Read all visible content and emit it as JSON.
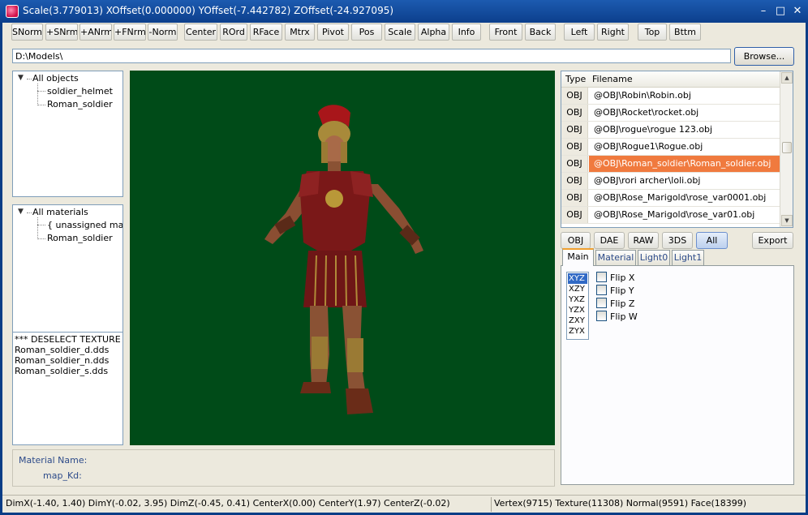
{
  "window": {
    "title": "Scale(3.779013) XOffset(0.000000) YOffset(-7.442782) ZOffset(-24.927095)",
    "controls": {
      "minimize": "–",
      "maximize": "□",
      "close": "✕"
    },
    "icon": "app-cube-icon"
  },
  "toolbar": {
    "buttons": [
      "SNorm",
      "+SNrm",
      "+ANrm",
      "+FNrm",
      "-Norm",
      "Center",
      "ROrd",
      "RFace",
      "Mtrx",
      "Pivot",
      "Pos",
      "Scale",
      "Alpha",
      "Info",
      "Front",
      "Back",
      "Left",
      "Right",
      "Top",
      "Bttm"
    ]
  },
  "path": {
    "value": "D:\\Models\\",
    "browse_label": "Browse..."
  },
  "objects_tree": {
    "root": "All objects",
    "items": [
      "soldier_helmet",
      "Roman_soldier"
    ]
  },
  "materials_tree": {
    "root": "All materials",
    "items": [
      "{ unassigned mater",
      "Roman_soldier"
    ],
    "scroll_left": "◀",
    "scroll_right": "▶"
  },
  "textures": {
    "items": [
      "*** DESELECT TEXTURE ***",
      "Roman_soldier_d.dds",
      "Roman_soldier_n.dds",
      "Roman_soldier_s.dds"
    ]
  },
  "material_info": {
    "name_label": "Material Name:",
    "map_label": "map_Kd:"
  },
  "file_list": {
    "headers": {
      "type": "Type",
      "filename": "Filename"
    },
    "rows": [
      {
        "type": "OBJ",
        "name": "@OBJ\\Robin\\Robin.obj"
      },
      {
        "type": "OBJ",
        "name": "@OBJ\\Rocket\\rocket.obj"
      },
      {
        "type": "OBJ",
        "name": "@OBJ\\rogue\\rogue 123.obj"
      },
      {
        "type": "OBJ",
        "name": "@OBJ\\Rogue1\\Rogue.obj"
      },
      {
        "type": "OBJ",
        "name": "@OBJ\\Roman_soldier\\Roman_soldier.obj",
        "selected": true
      },
      {
        "type": "OBJ",
        "name": "@OBJ\\rori archer\\loli.obj"
      },
      {
        "type": "OBJ",
        "name": "@OBJ\\Rose_Marigold\\rose_var0001.obj"
      },
      {
        "type": "OBJ",
        "name": "@OBJ\\Rose_Marigold\\rose_var01.obj"
      }
    ],
    "scroll_up": "▲",
    "scroll_down": "▼",
    "selection_color": "#f07a3e"
  },
  "format_filters": {
    "buttons": [
      "OBJ",
      "DAE",
      "RAW",
      "3DS",
      "All"
    ],
    "active": "All",
    "export_label": "Export"
  },
  "tabs": {
    "items": [
      "Main",
      "Material",
      "Light0",
      "Light1"
    ],
    "active": "Main"
  },
  "main_tab": {
    "axis_orders": [
      "XYZ",
      "XZY",
      "YXZ",
      "YZX",
      "ZXY",
      "ZYX"
    ],
    "selected_order": "XYZ",
    "flips": [
      "Flip X",
      "Flip Y",
      "Flip Z",
      "Flip W"
    ]
  },
  "status": {
    "dims": "DimX(-1.40, 1.40) DimY(-0.02, 3.95) DimZ(-0.45, 0.41) CenterX(0.00) CenterY(1.97) CenterZ(-0.02)",
    "counts": "Vertex(9715) Texture(11308) Normal(9591) Face(18399)"
  },
  "viewport": {
    "background": "#004b18",
    "model": "roman-soldier-model"
  }
}
